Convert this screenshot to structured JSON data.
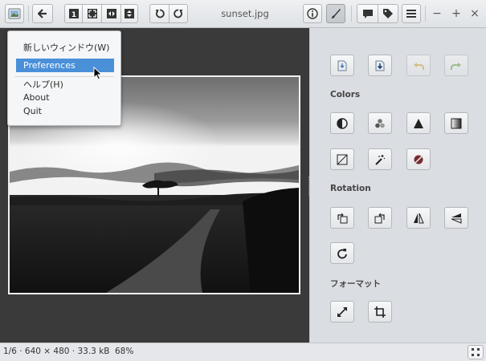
{
  "window": {
    "title": "sunset.jpg"
  },
  "toolbar": {
    "app_menu_icon": "image-viewer-icon",
    "back_icon": "go-back-icon",
    "fit_1to1_icon": "zoom-original-icon",
    "fit_best_icon": "zoom-fit-best-icon",
    "fit_width_icon": "zoom-fit-width-icon",
    "fit_height_icon": "zoom-fit-height-icon",
    "rotate_left_icon": "rotate-left-icon",
    "rotate_right_icon": "rotate-right-icon",
    "properties_icon": "info-icon",
    "edit_icon": "paintbrush-icon",
    "comment_icon": "comment-icon",
    "tag_icon": "tag-icon",
    "menu_icon": "hamburger-menu-icon",
    "minimize": "−",
    "maximize": "+",
    "close": "×"
  },
  "app_menu": {
    "items": [
      "新しいウィンドウ(W)",
      "Preferences",
      "ヘルプ(H)",
      "About",
      "Quit"
    ],
    "highlighted_index": 1
  },
  "sidebar": {
    "top_buttons": [
      "save-icon",
      "save-as-icon",
      "undo-icon",
      "redo-icon"
    ],
    "sections": [
      {
        "label": "Colors",
        "buttons": [
          "contrast-icon",
          "colors-icon",
          "sharpen-icon",
          "gradient-icon",
          "curves-icon",
          "magic-wand-icon",
          "red-eye-icon"
        ]
      },
      {
        "label": "Rotation",
        "buttons": [
          "rotate-left-icon",
          "rotate-right-icon",
          "flip-horizontal-icon",
          "flip-vertical-icon",
          "rotate-free-icon"
        ]
      },
      {
        "label": "フォーマット",
        "buttons": [
          "resize-icon",
          "crop-icon"
        ]
      }
    ]
  },
  "status": {
    "info": "1/6 · 640 × 480 · 33.3 kB",
    "zoom": "68%"
  },
  "colors": {
    "accent": "#4a90d9",
    "viewer_bg": "#3a3a3a",
    "sidebar_bg": "#dadde2"
  }
}
